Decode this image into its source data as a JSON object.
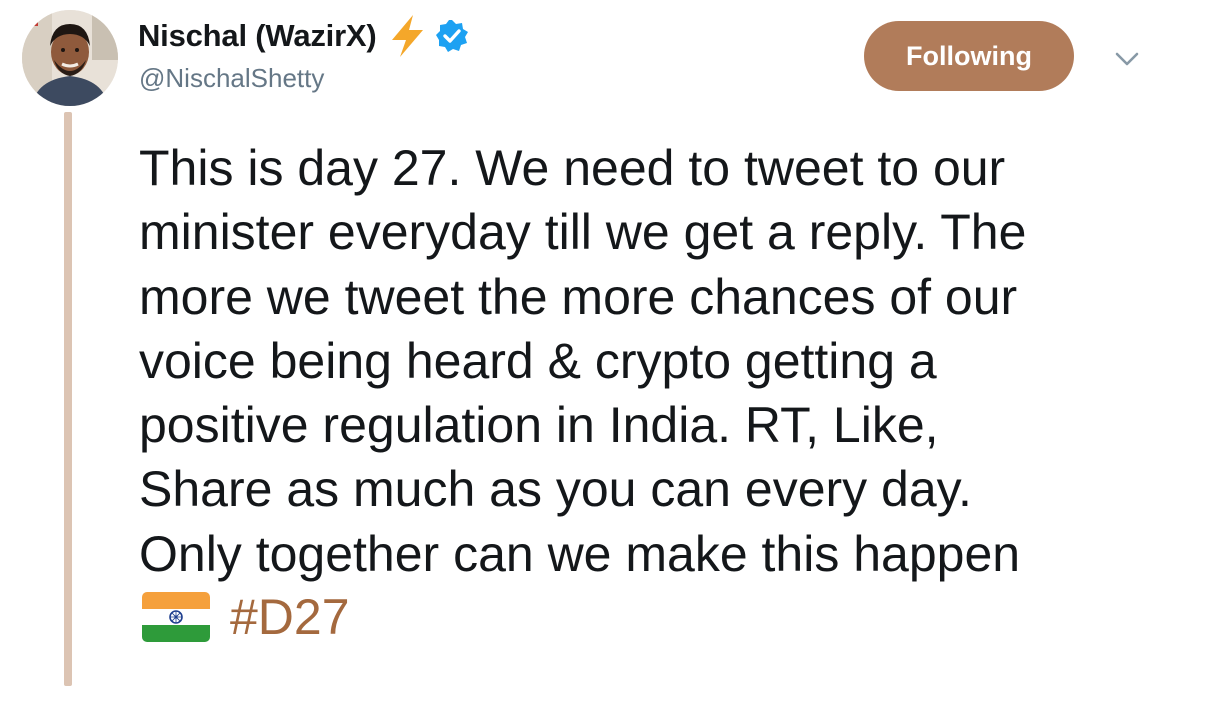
{
  "tweet": {
    "author": {
      "display_name": "Nischal (WazirX)",
      "handle": "@NischalShetty",
      "name_emoji_icon": "lightning-bolt-icon",
      "verified_icon": "verified-badge-icon"
    },
    "follow_button_label": "Following",
    "menu_icon": "chevron-down-icon",
    "text_lines": [
      "This is day 27. We need to tweet to our",
      "minister everyday till we get a reply. The",
      "more we tweet the more chances of our",
      "voice being heard & crypto getting a",
      "positive regulation in India. RT, Like,",
      "Share as much as you can every day.",
      "Only together can we make this happen"
    ],
    "flag_icon": "india-flag-icon",
    "hashtag": "#D27"
  },
  "colors": {
    "accent": "#b17c5a",
    "hashtag": "#a4693e",
    "thread_line": "#dcc4b3",
    "verified": "#1da1f2",
    "bolt": "#f4a72a",
    "secondary_text": "#657786"
  }
}
